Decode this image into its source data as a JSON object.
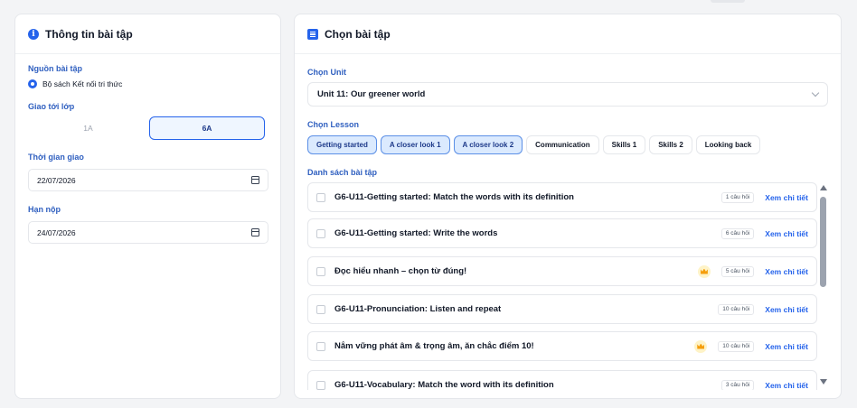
{
  "left": {
    "title": "Thông tin bài tập",
    "source_label": "Nguồn bài tập",
    "source_option": "Bộ sách Kết nối tri thức",
    "class_label": "Giao tới lớp",
    "classes": [
      "1A",
      "6A"
    ],
    "start_label": "Thời gian giao",
    "start_date": "22/07/2026",
    "due_label": "Hạn nộp",
    "due_date": "24/07/2026"
  },
  "right": {
    "title": "Chọn bài tập",
    "unit_label": "Chọn Unit",
    "unit_value": "Unit 11: Our greener world",
    "lesson_label": "Chọn Lesson",
    "lessons": [
      {
        "label": "Getting started",
        "selected": true
      },
      {
        "label": "A closer look 1",
        "selected": true
      },
      {
        "label": "A closer look 2",
        "selected": true
      },
      {
        "label": "Communication",
        "selected": false
      },
      {
        "label": "Skills 1",
        "selected": false
      },
      {
        "label": "Skills 2",
        "selected": false
      },
      {
        "label": "Looking back",
        "selected": false
      }
    ],
    "list_label": "Danh sách bài tập",
    "exercises": [
      {
        "title": "G6-U11-Getting started: Match the words with its definition",
        "count": "1 câu hỏi",
        "premium": false
      },
      {
        "title": "G6-U11-Getting started: Write the words",
        "count": "6 câu hỏi",
        "premium": false
      },
      {
        "title": "Đọc hiểu nhanh – chọn từ đúng!",
        "count": "5 câu hỏi",
        "premium": true
      },
      {
        "title": "G6-U11-Pronunciation: Listen and repeat",
        "count": "10 câu hỏi",
        "premium": false
      },
      {
        "title": "Nắm vững phát âm & trọng âm, ăn chắc điểm 10!",
        "count": "10 câu hỏi",
        "premium": true
      },
      {
        "title": "G6-U11-Vocabulary: Match the word with its definition",
        "count": "3 câu hỏi",
        "premium": false
      }
    ],
    "detail_link": "Xem chi tiết"
  },
  "colors": {
    "accent": "#2563eb",
    "label": "#3060c0",
    "premium": "#f59e0b"
  }
}
